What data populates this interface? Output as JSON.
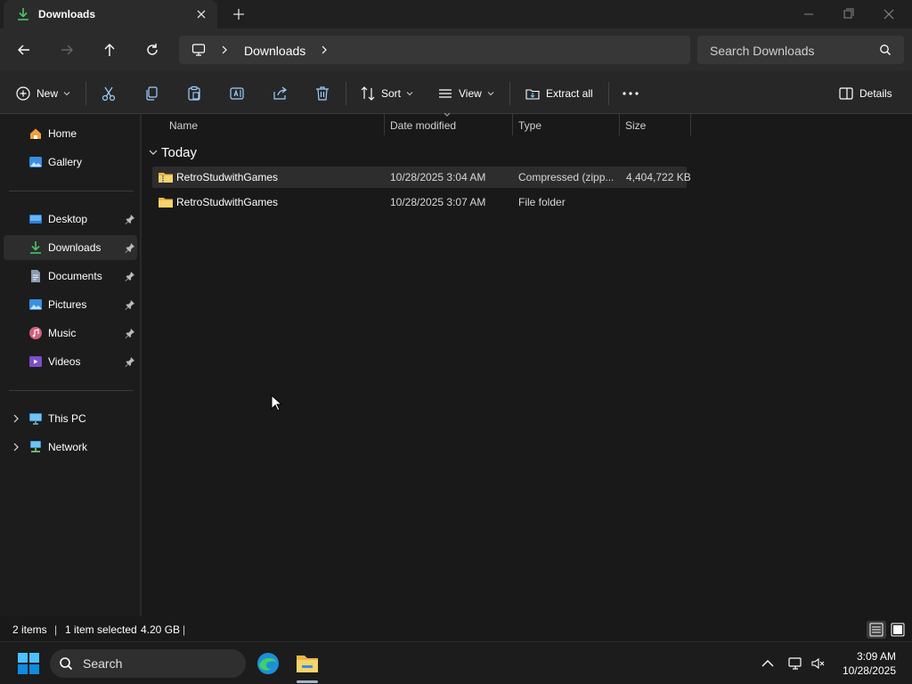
{
  "window": {
    "tab_title": "Downloads"
  },
  "addressbar": {
    "crumb": "Downloads",
    "search_placeholder": "Search Downloads"
  },
  "commandbar": {
    "new_label": "New",
    "sort_label": "Sort",
    "view_label": "View",
    "extract_label": "Extract all",
    "details_label": "Details"
  },
  "sidebar": {
    "top": [
      {
        "label": "Home",
        "icon": "home-icon"
      },
      {
        "label": "Gallery",
        "icon": "gallery-icon"
      }
    ],
    "quick": [
      {
        "label": "Desktop",
        "icon": "desktop-icon"
      },
      {
        "label": "Downloads",
        "icon": "downloads-icon"
      },
      {
        "label": "Documents",
        "icon": "documents-icon"
      },
      {
        "label": "Pictures",
        "icon": "pictures-icon"
      },
      {
        "label": "Music",
        "icon": "music-icon"
      },
      {
        "label": "Videos",
        "icon": "videos-icon"
      }
    ],
    "bottom": [
      {
        "label": "This PC",
        "icon": "this-pc-icon"
      },
      {
        "label": "Network",
        "icon": "network-icon"
      }
    ]
  },
  "columns": {
    "name": "Name",
    "date": "Date modified",
    "type": "Type",
    "size": "Size"
  },
  "group": {
    "label": "Today"
  },
  "files": [
    {
      "name": "RetroStudwithGames",
      "date": "10/28/2025 3:04 AM",
      "type": "Compressed (zipp...",
      "size": "4,404,722 KB",
      "icon": "zip-folder-icon",
      "selected": true
    },
    {
      "name": "RetroStudwithGames",
      "date": "10/28/2025 3:07 AM",
      "type": "File folder",
      "size": "",
      "icon": "folder-icon",
      "selected": false
    }
  ],
  "status": {
    "count": "2 items",
    "selection": "1 item selected",
    "selection_size": "4.20 GB"
  },
  "taskbar": {
    "search_label": "Search",
    "time": "3:09 AM",
    "date": "10/28/2025"
  },
  "colors": {
    "accent": "#60cdff",
    "folder": "#f2c94c",
    "download_green": "#4cc26a"
  }
}
